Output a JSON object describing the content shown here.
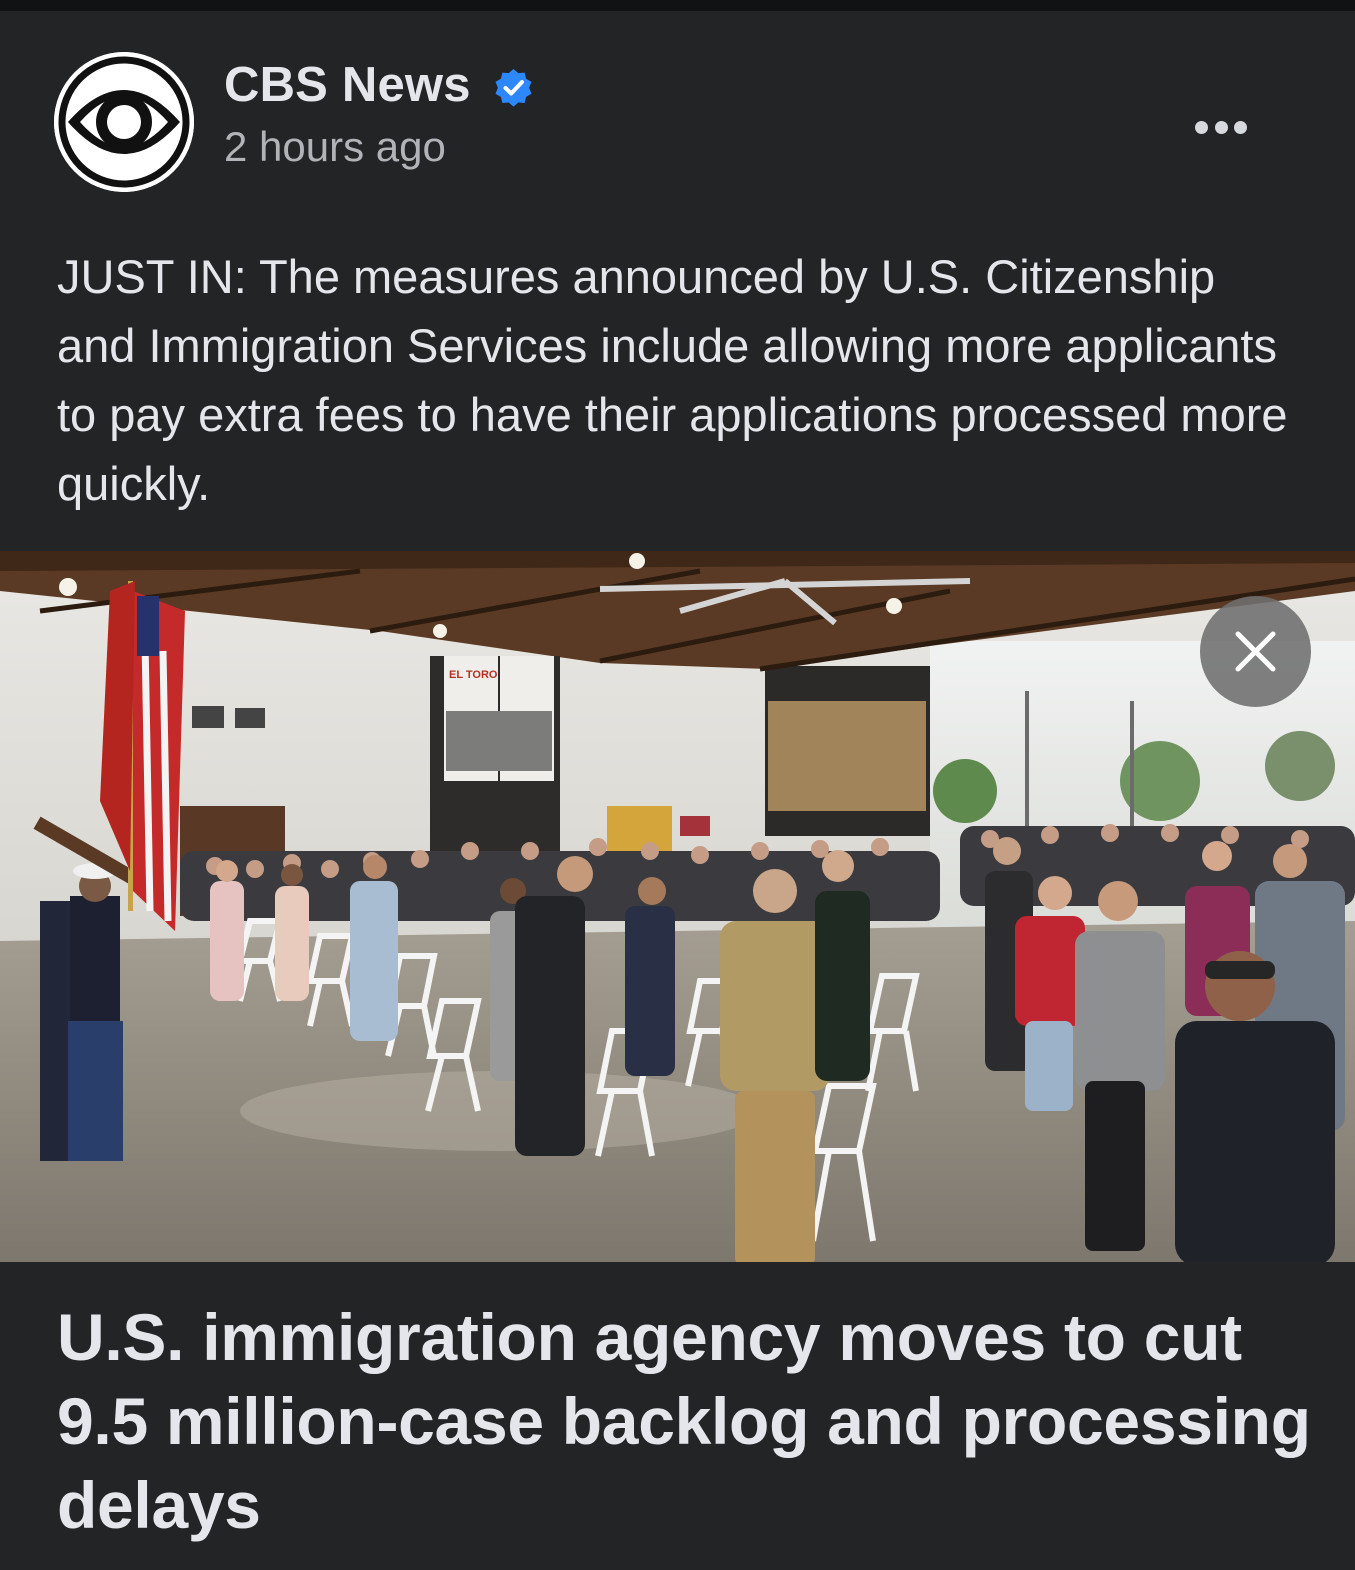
{
  "post": {
    "author": "CBS News",
    "verified": true,
    "timestamp": "2 hours ago",
    "caption": "JUST IN: The measures announced by U.S. Citizenship and Immigration Services include allowing more applicants to pay extra fees to have their applications processed more quickly.",
    "more_icon": "more-horizontal-icon"
  },
  "photo": {
    "sign_text": "EL TORO",
    "close_icon": "close-icon"
  },
  "link": {
    "headline": "U.S. immigration agency moves to cut 9.5 million-case backlog and processing delays"
  },
  "colors": {
    "background": "#232426",
    "text_primary": "#e4e6eb",
    "text_secondary": "#b0b3b8",
    "verified_badge": "#2d88ff"
  }
}
